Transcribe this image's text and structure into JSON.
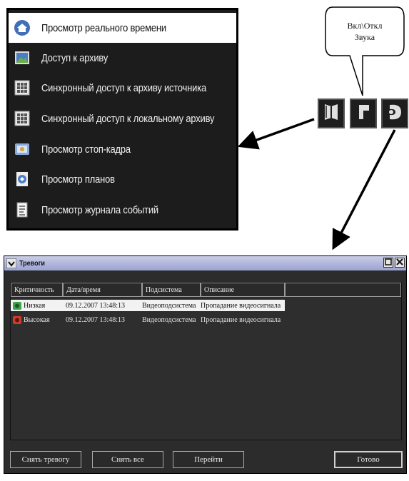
{
  "menu": {
    "items": [
      {
        "label": "Просмотр реального времени",
        "icon": "home-icon"
      },
      {
        "label": "Доступ к архиву",
        "icon": "archive-image-icon"
      },
      {
        "label": "Синхронный доступ к архиву источника",
        "icon": "grid-icon"
      },
      {
        "label": "Синхронный доступ к локальному архиву",
        "icon": "grid-icon"
      },
      {
        "label": "Просмотр стоп-кадра",
        "icon": "snapshot-icon"
      },
      {
        "label": "Просмотр планов",
        "icon": "plan-icon"
      },
      {
        "label": "Просмотр журнала событий",
        "icon": "document-icon"
      }
    ]
  },
  "callout": {
    "text": "Вкл\\Откл Звука"
  },
  "toolbar": {
    "icons": [
      "book-icon",
      "sound-icon",
      "phone-icon"
    ]
  },
  "alarm_window": {
    "title": "Тревоги",
    "columns": [
      "Критичность",
      "Дата/время",
      "Подсистема",
      "Описание",
      ""
    ],
    "rows": [
      {
        "severity": "Низкая",
        "datetime": "09.12.2007 13:48:13",
        "subsystem": "Видеоподсистема",
        "description": "Пропадание видеосигнала",
        "severity_color": "#3aa84a"
      },
      {
        "severity": "Высокая",
        "datetime": "09.12.2007 13:48:13",
        "subsystem": "Видеоподсистема",
        "description": "Пропадание видеосигнала",
        "severity_color": "#d23a2a"
      }
    ],
    "buttons": {
      "clear_alarm": "Снять тревогу",
      "clear_all": "Снять все",
      "go": "Перейти",
      "done": "Готово"
    }
  }
}
